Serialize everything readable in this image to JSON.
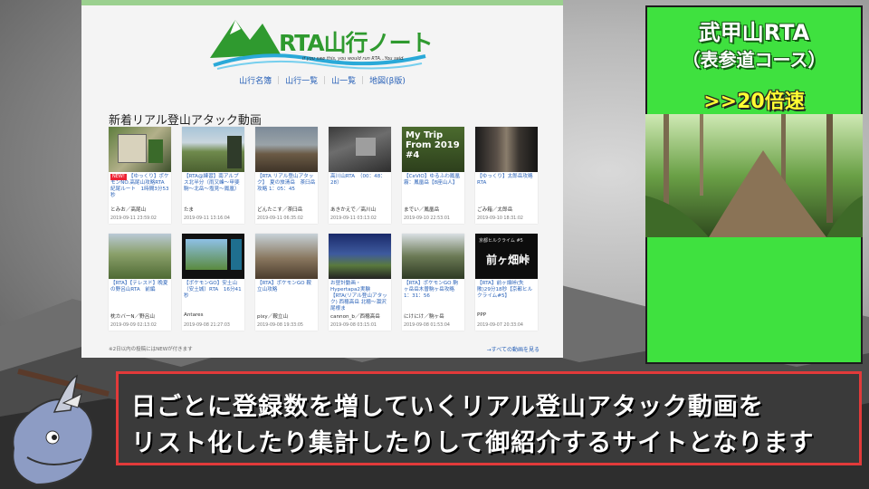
{
  "site": {
    "logo_text": "RTA山行ノート",
    "logo_sub": "if you saw this, you would run RTA...You said.",
    "nav": [
      "山行名簿",
      "山行一覧",
      "山一覧",
      "地図(β版)"
    ],
    "section_title": "新着リアル登山アタック動画",
    "new_badge": "NEW!",
    "cards": [
      {
        "title": "【ゆっくり】ポケモンNO.高尾山攻略RTA　紀尾ルート　1時間3分53秒",
        "author": "とみお／高尾山",
        "date": "2019-09-11 23:59:02",
        "is_new": true
      },
      {
        "title": "【RTA@練習】南アルプス北半分（雨又峰～甲斐駒～北岳～塩見～鳳凰）",
        "author": "たま",
        "date": "2019-09-11 13:16:04",
        "is_new": false
      },
      {
        "title": "【RTA リアル登山アタック】　夏の旅清岳　茶臼岳攻略 1：05：45",
        "author": "どんたこす／茶臼岳",
        "date": "2019-09-11 06:35:02",
        "is_new": false
      },
      {
        "title": "高川山RTA　（00：48：28）",
        "author": "あきかえで／高川山",
        "date": "2019-09-11 03:13:02",
        "is_new": false
      },
      {
        "title": "【CeVIO】ゆるふわ鳳凰霧：鳳凰岳【8座山人】",
        "author": "までい／鳳凰岳",
        "date": "2019-09-10 22:53:01",
        "is_new": false
      },
      {
        "title": "【ゆっくり】太郎岳攻略RTA",
        "author": "ごみ箱／太郎岳",
        "date": "2019-09-10 18:31:02",
        "is_new": false
      },
      {
        "title": "【RTA】【テレスド】晩夏の野呂山RTA　前編",
        "author": "枕カバーN／野呂山",
        "date": "2019-09-09 02:13:02",
        "is_new": false
      },
      {
        "title": "【ポケモンGO】安土山（安土城）RTA　16分41秒",
        "author": "Antares",
        "date": "2019-09-08 21:27:03",
        "is_new": false
      },
      {
        "title": "【RTA】ポケモンGO 鞍立山攻略",
        "author": "pixy／鞍立山",
        "date": "2019-09-08 19:33:05",
        "is_new": false
      },
      {
        "title": "お昼計動画・Hypertapa2実験【RTA(リアル登山アタック) 西穂高岳 北穂～涸沢尾根ま",
        "author": "cannon_b／西穂高岳",
        "date": "2019-09-08 03:15:01",
        "is_new": false
      },
      {
        "title": "【RTA】ポケモンGO 駒ヶ岳岳木曽駒ヶ岳攻略1：31：56",
        "author": "にけにけ／駒ヶ岳",
        "date": "2019-09-08 01:53:04",
        "is_new": false
      },
      {
        "title": "【RTA】前ヶ畑峠(失敗)29分18秒【京都ヒルクライム#5】",
        "author": "PPP",
        "date": "2019-09-07 20:33:04",
        "is_new": false
      }
    ],
    "thumb_text_4": "My Trip From 2019 #4",
    "thumb_text_11a": "京都ヒルクライム #5",
    "thumb_text_11b": "前ヶ畑峠",
    "footnote": "※2日以内の投稿にはNEWが付きます",
    "see_all": "→すべての動画を見る"
  },
  "overlay": {
    "title": "武甲山RTA",
    "course": "（表参道コース）",
    "speed": ">>20倍速",
    "subtitle_line1": "日ごとに登録数を増していくリアル登山アタック動画を",
    "subtitle_line2": "リスト化したり集計したりして御紹介するサイトとなります"
  },
  "colors": {
    "accent_green": "#3fe13f",
    "subtitle_border": "#e23a3a",
    "link_blue": "#2a62b8",
    "speed_yellow": "#ffff33"
  }
}
